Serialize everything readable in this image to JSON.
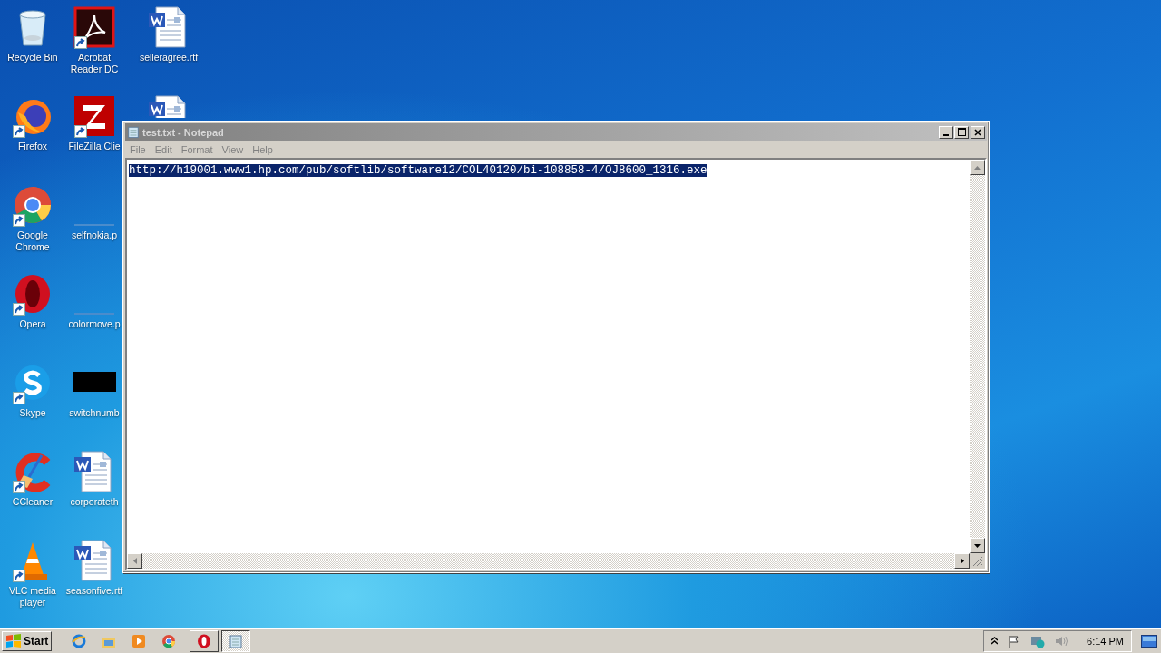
{
  "desktop": {
    "icons": [
      {
        "label": "Recycle Bin",
        "kind": "recycle",
        "shortcut": false
      },
      {
        "label": "Firefox",
        "kind": "firefox",
        "shortcut": true
      },
      {
        "label": "Google Chrome",
        "kind": "chrome",
        "shortcut": true
      },
      {
        "label": "Opera",
        "kind": "opera",
        "shortcut": true
      },
      {
        "label": "Skype",
        "kind": "skype",
        "shortcut": true
      },
      {
        "label": "CCleaner",
        "kind": "ccleaner",
        "shortcut": true
      },
      {
        "label": "VLC media player",
        "kind": "vlc",
        "shortcut": true
      },
      {
        "label": "Acrobat Reader DC",
        "kind": "pdf",
        "shortcut": true
      },
      {
        "label": "FileZilla Clie",
        "kind": "filezilla",
        "shortcut": true
      },
      {
        "label": "selfnokia.p",
        "kind": "blank",
        "shortcut": false
      },
      {
        "label": "colormove.p",
        "kind": "blank",
        "shortcut": false
      },
      {
        "label": "switchnumb",
        "kind": "black",
        "shortcut": false
      },
      {
        "label": "corporateth",
        "kind": "word",
        "shortcut": false
      },
      {
        "label": "seasonfive.rtf",
        "kind": "word",
        "shortcut": false
      },
      {
        "label": "selleragree.rtf",
        "kind": "word",
        "shortcut": false
      },
      {
        "kind": "word_top",
        "shortcut": false
      }
    ]
  },
  "notepad": {
    "title": "test.txt - Notepad",
    "active": false,
    "menu": [
      "File",
      "Edit",
      "Format",
      "View",
      "Help"
    ],
    "content": "http://h19001.www1.hp.com/pub/softlib/software12/COL40120/bi-108858-4/OJ8600_1316.exe",
    "content_selected": true
  },
  "taskbar": {
    "start": "Start",
    "quick_launch": [
      {
        "kind": "ie"
      },
      {
        "kind": "folder"
      },
      {
        "kind": "media"
      },
      {
        "kind": "chrome"
      }
    ],
    "tasks": [
      {
        "kind": "opera",
        "active": false
      },
      {
        "kind": "notepad",
        "active": true
      }
    ],
    "clock": "6:14 PM"
  }
}
